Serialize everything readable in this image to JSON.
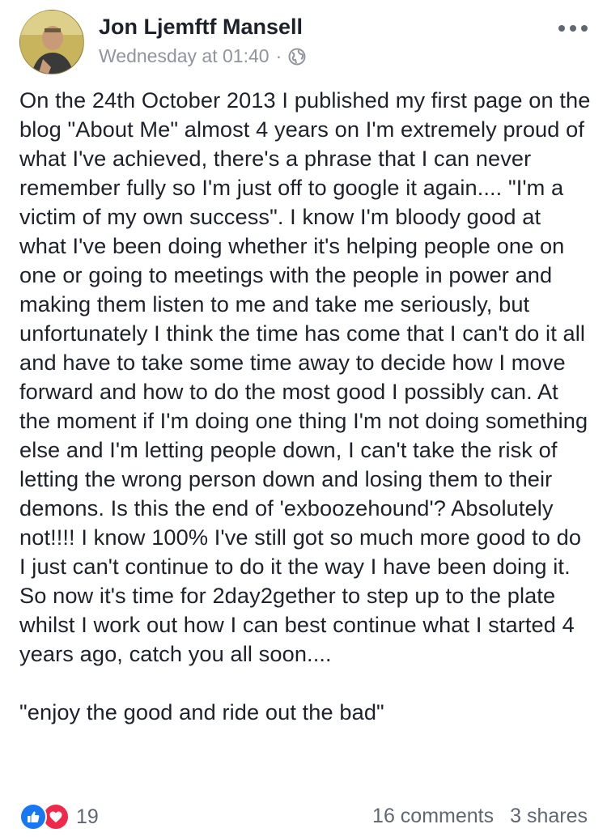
{
  "post": {
    "author": "Jon Ljemftf Mansell",
    "timestamp": "Wednesday at 01:40",
    "separator": "·",
    "privacy_icon": "globe-icon",
    "menu_icon": "more-options-icon",
    "body": "On the 24th October 2013 I published my first page on the blog \"About Me\" almost 4 years on I'm extremely proud of what I've achieved, there's a phrase that I can never remember fully so I'm just off to google it again.... \"I'm a victim of my own success\". I know I'm bloody good at what I've been doing whether it's helping people one on one or going to meetings with the people in power and making them listen to me and take me seriously, but unfortunately I think the time has come that I can't do it all and have to take some time away to decide how I move forward and how to do the most good I possibly can. At the moment if I'm doing one thing I'm not doing something else and I'm letting people down, I can't take the risk of letting the wrong person down and losing them to their demons. Is this the end of 'exboozehound'? Absolutely not!!!! I know 100% I've still got so much more good to do I just can't continue to do it the way I have been doing it. So now it's time for 2day2gether to step up to the plate whilst I work out how I can best continue what I started 4 years ago, catch you all soon....",
    "quote": "\"enjoy the good and ride out the bad\""
  },
  "footer": {
    "reaction_icons": [
      "like-icon",
      "love-icon"
    ],
    "reaction_count": "19",
    "comments": "16 comments",
    "shares": "3 shares"
  },
  "colors": {
    "text": "#1d2129",
    "meta": "#90949c",
    "like": "#1877f2",
    "love": "#f0284a"
  }
}
